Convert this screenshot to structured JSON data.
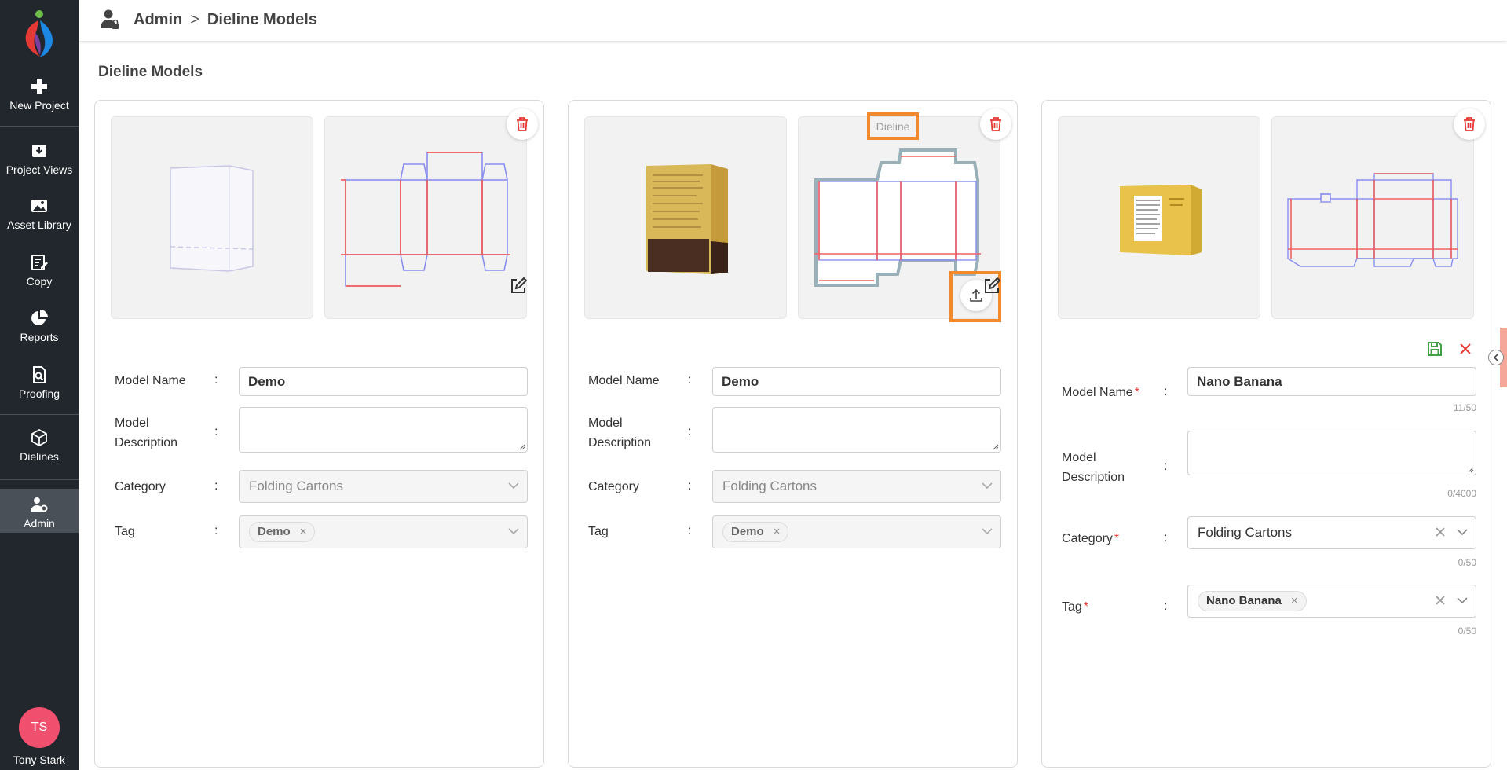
{
  "sidebar": {
    "items": [
      {
        "label": "New Project",
        "icon": "plus-icon"
      },
      {
        "label": "Project Views",
        "icon": "inbox-download-icon"
      },
      {
        "label": "Asset Library",
        "icon": "image-icon"
      },
      {
        "label": "Copy",
        "icon": "edit-document-icon"
      },
      {
        "label": "Reports",
        "icon": "pie-chart-icon"
      },
      {
        "label": "Proofing",
        "icon": "document-search-icon"
      },
      {
        "label": "Dielines",
        "icon": "cube-icon"
      },
      {
        "label": "Admin",
        "icon": "user-settings-icon",
        "active": true
      }
    ],
    "user": {
      "initials": "TS",
      "name": "Tony Stark"
    }
  },
  "header": {
    "section": "Admin",
    "separator": ">",
    "page": "Dieline Models"
  },
  "page_title": "Dieline Models",
  "colors": {
    "sidebar_bg": "#22272e",
    "highlight": "#f08a2c",
    "avatar": "#f0506e",
    "delete": "#e53935",
    "save": "#43a047"
  },
  "cards": [
    {
      "model_name_label": "Model Name",
      "model_name": "Demo",
      "description_label_1": "Model",
      "description_label_2": "Description",
      "category_label": "Category",
      "category": "Folding Cartons",
      "tag_label": "Tag",
      "tag": "Demo",
      "chip_x": "×",
      "colon": ":"
    },
    {
      "model_name_label": "Model Name",
      "model_name": "Demo",
      "description_label_1": "Model",
      "description_label_2": "Description",
      "category_label": "Category",
      "category": "Folding Cartons",
      "tag_label": "Tag",
      "tag": "Demo",
      "chip_x": "×",
      "colon": ":",
      "dieline_tag": "Dieline"
    },
    {
      "model_name_label": "Model Name",
      "model_name": "Nano Banana",
      "model_name_counter": "11/50",
      "description_label_1": "Model",
      "description_label_2": "Description",
      "description_counter": "0/4000",
      "category_label": "Category",
      "category": "Folding Cartons",
      "category_counter": "0/50",
      "tag_label": "Tag",
      "tag": "Nano Banana",
      "tag_counter": "0/50",
      "chip_x": "×",
      "colon": ":",
      "required_mark": "*"
    }
  ]
}
